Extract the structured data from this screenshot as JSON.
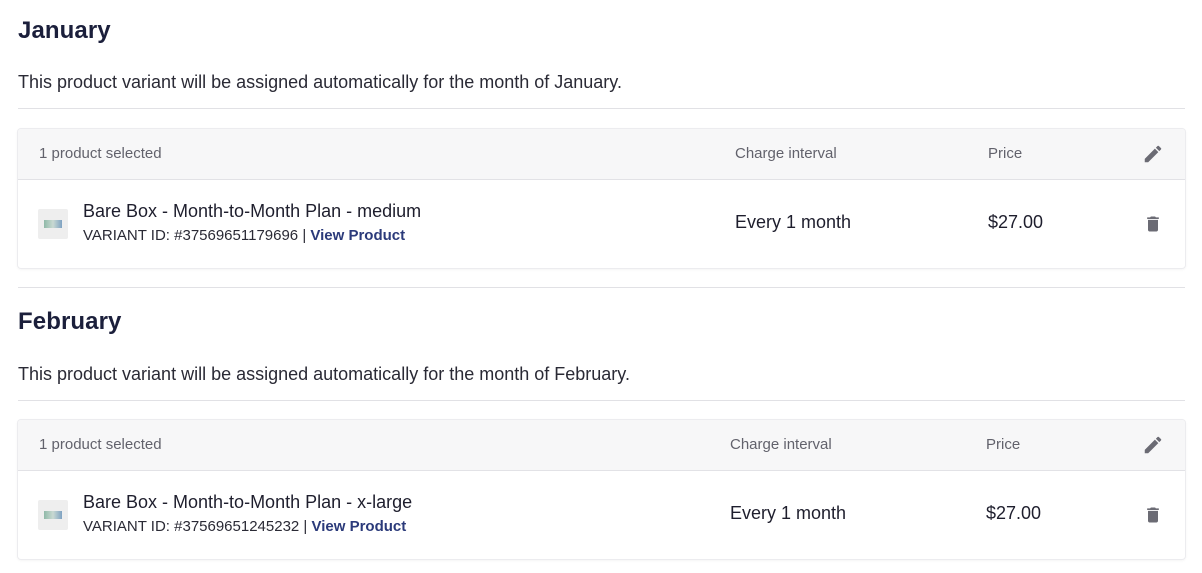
{
  "sections": [
    {
      "title": "January",
      "description": "This product variant will be assigned automatically for the month of January.",
      "table": {
        "selected_count": "1 product selected",
        "interval_header": "Charge interval",
        "price_header": "Price",
        "product": {
          "name": "Bare Box - Month-to-Month Plan - medium",
          "variant_prefix": "VARIANT ID: #37569651179696 |",
          "view_link": "View Product",
          "interval": "Every 1 month",
          "price": "$27.00"
        }
      }
    },
    {
      "title": "February",
      "description": "This product variant will be assigned automatically for the month of February.",
      "table": {
        "selected_count": "1 product selected",
        "interval_header": "Charge interval",
        "price_header": "Price",
        "product": {
          "name": "Bare Box - Month-to-Month Plan - x-large",
          "variant_prefix": "VARIANT ID: #37569651245232 |",
          "view_link": "View Product",
          "interval": "Every 1 month",
          "price": "$27.00"
        }
      }
    }
  ],
  "icons": {
    "edit": "pencil-icon",
    "delete": "trash-icon",
    "thumbnail": "product-thumbnail"
  },
  "colors": {
    "heading": "#1b1f3b",
    "link": "#2b3a7a",
    "icon": "#6b6b74",
    "header_bg": "#f7f7f8"
  }
}
